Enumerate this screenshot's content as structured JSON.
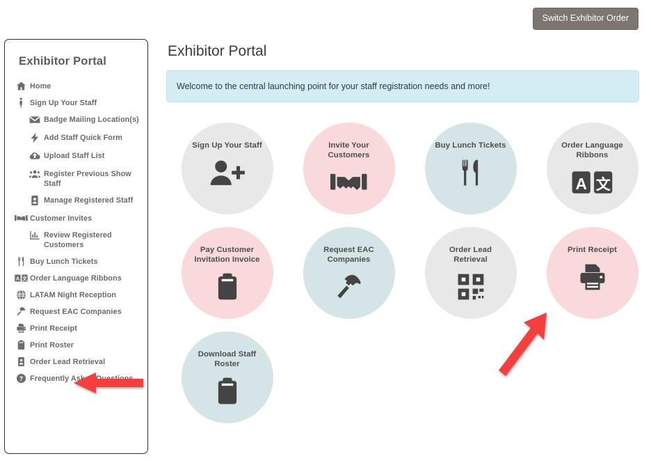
{
  "top_strip": {
    "text": ""
  },
  "toolbar": {
    "switch_order_label": "Switch Exhibitor Order"
  },
  "sidebar": {
    "title": "Exhibitor Portal",
    "items": [
      {
        "label": "Home",
        "icon": "home-icon",
        "level": 0
      },
      {
        "label": "Sign Up Your Staff",
        "icon": "person-icon",
        "level": 0
      },
      {
        "label": "Badge Mailing Location(s)",
        "icon": "envelope-icon",
        "level": 1
      },
      {
        "label": "Add Staff Quick Form",
        "icon": "bolt-icon",
        "level": 1
      },
      {
        "label": "Upload Staff List",
        "icon": "cloud-upload-icon",
        "level": 1
      },
      {
        "label": "Register Previous Show Staff",
        "icon": "users-icon",
        "level": 1
      },
      {
        "label": "Manage Registered Staff",
        "icon": "id-badge-icon",
        "level": 1
      },
      {
        "label": "Customer Invites",
        "icon": "handshake-icon",
        "level": 0
      },
      {
        "label": "Review Registered Customers",
        "icon": "bar-chart-icon",
        "level": 1
      },
      {
        "label": "Buy Lunch Tickets",
        "icon": "utensils-icon",
        "level": 0
      },
      {
        "label": "Order Language Ribbons",
        "icon": "language-icon",
        "level": 0
      },
      {
        "label": "LATAM Night Reception",
        "icon": "globe-icon",
        "level": 0
      },
      {
        "label": "Request EAC Companies",
        "icon": "hammer-icon",
        "level": 0
      },
      {
        "label": "Print Receipt",
        "icon": "printer-icon",
        "level": 0
      },
      {
        "label": "Print Roster",
        "icon": "clipboard-icon",
        "level": 0
      },
      {
        "label": "Order Lead Retrieval",
        "icon": "id-badge-icon",
        "level": 0
      },
      {
        "label": "Frequently Asked Questions",
        "icon": "question-circle-icon",
        "level": 0
      }
    ]
  },
  "main": {
    "page_title": "Exhibitor Portal",
    "welcome_message": "Welcome to the central launching point for your staff registration needs and more!",
    "tiles": [
      {
        "label": "Sign Up Your Staff",
        "icon": "user-plus-icon",
        "color": "gray"
      },
      {
        "label": "Invite Your Customers",
        "icon": "handshake-icon",
        "color": "pink"
      },
      {
        "label": "Buy Lunch Tickets",
        "icon": "utensils-icon",
        "color": "teal"
      },
      {
        "label": "Order Language Ribbons",
        "icon": "language-icon",
        "color": "gray"
      },
      {
        "label": "Pay Customer Invitation Invoice",
        "icon": "clipboard-icon",
        "color": "pink"
      },
      {
        "label": "Request EAC Companies",
        "icon": "hammer-icon",
        "color": "teal"
      },
      {
        "label": "Order Lead Retrieval",
        "icon": "qrcode-icon",
        "color": "gray"
      },
      {
        "label": "Print Receipt",
        "icon": "printer-icon",
        "color": "pink"
      },
      {
        "label": "Download Staff Roster",
        "icon": "clipboard-icon",
        "color": "teal"
      }
    ]
  },
  "annotations": {
    "arrow_color": "#f43f3f",
    "arrows": [
      {
        "name": "arrow-pointing-to-print-receipt-menu",
        "direction": "left"
      },
      {
        "name": "arrow-pointing-to-print-receipt-tile",
        "direction": "up-right"
      }
    ]
  },
  "colors": {
    "gray_circle": "#e8e8e8",
    "pink_circle": "#f9d9d9",
    "teal_circle": "#d4e4e7",
    "banner_blue": "#d4ecf4",
    "button_gray": "#7c7570",
    "icon_dark": "#444444",
    "text_gray": "#6a6a6a"
  }
}
